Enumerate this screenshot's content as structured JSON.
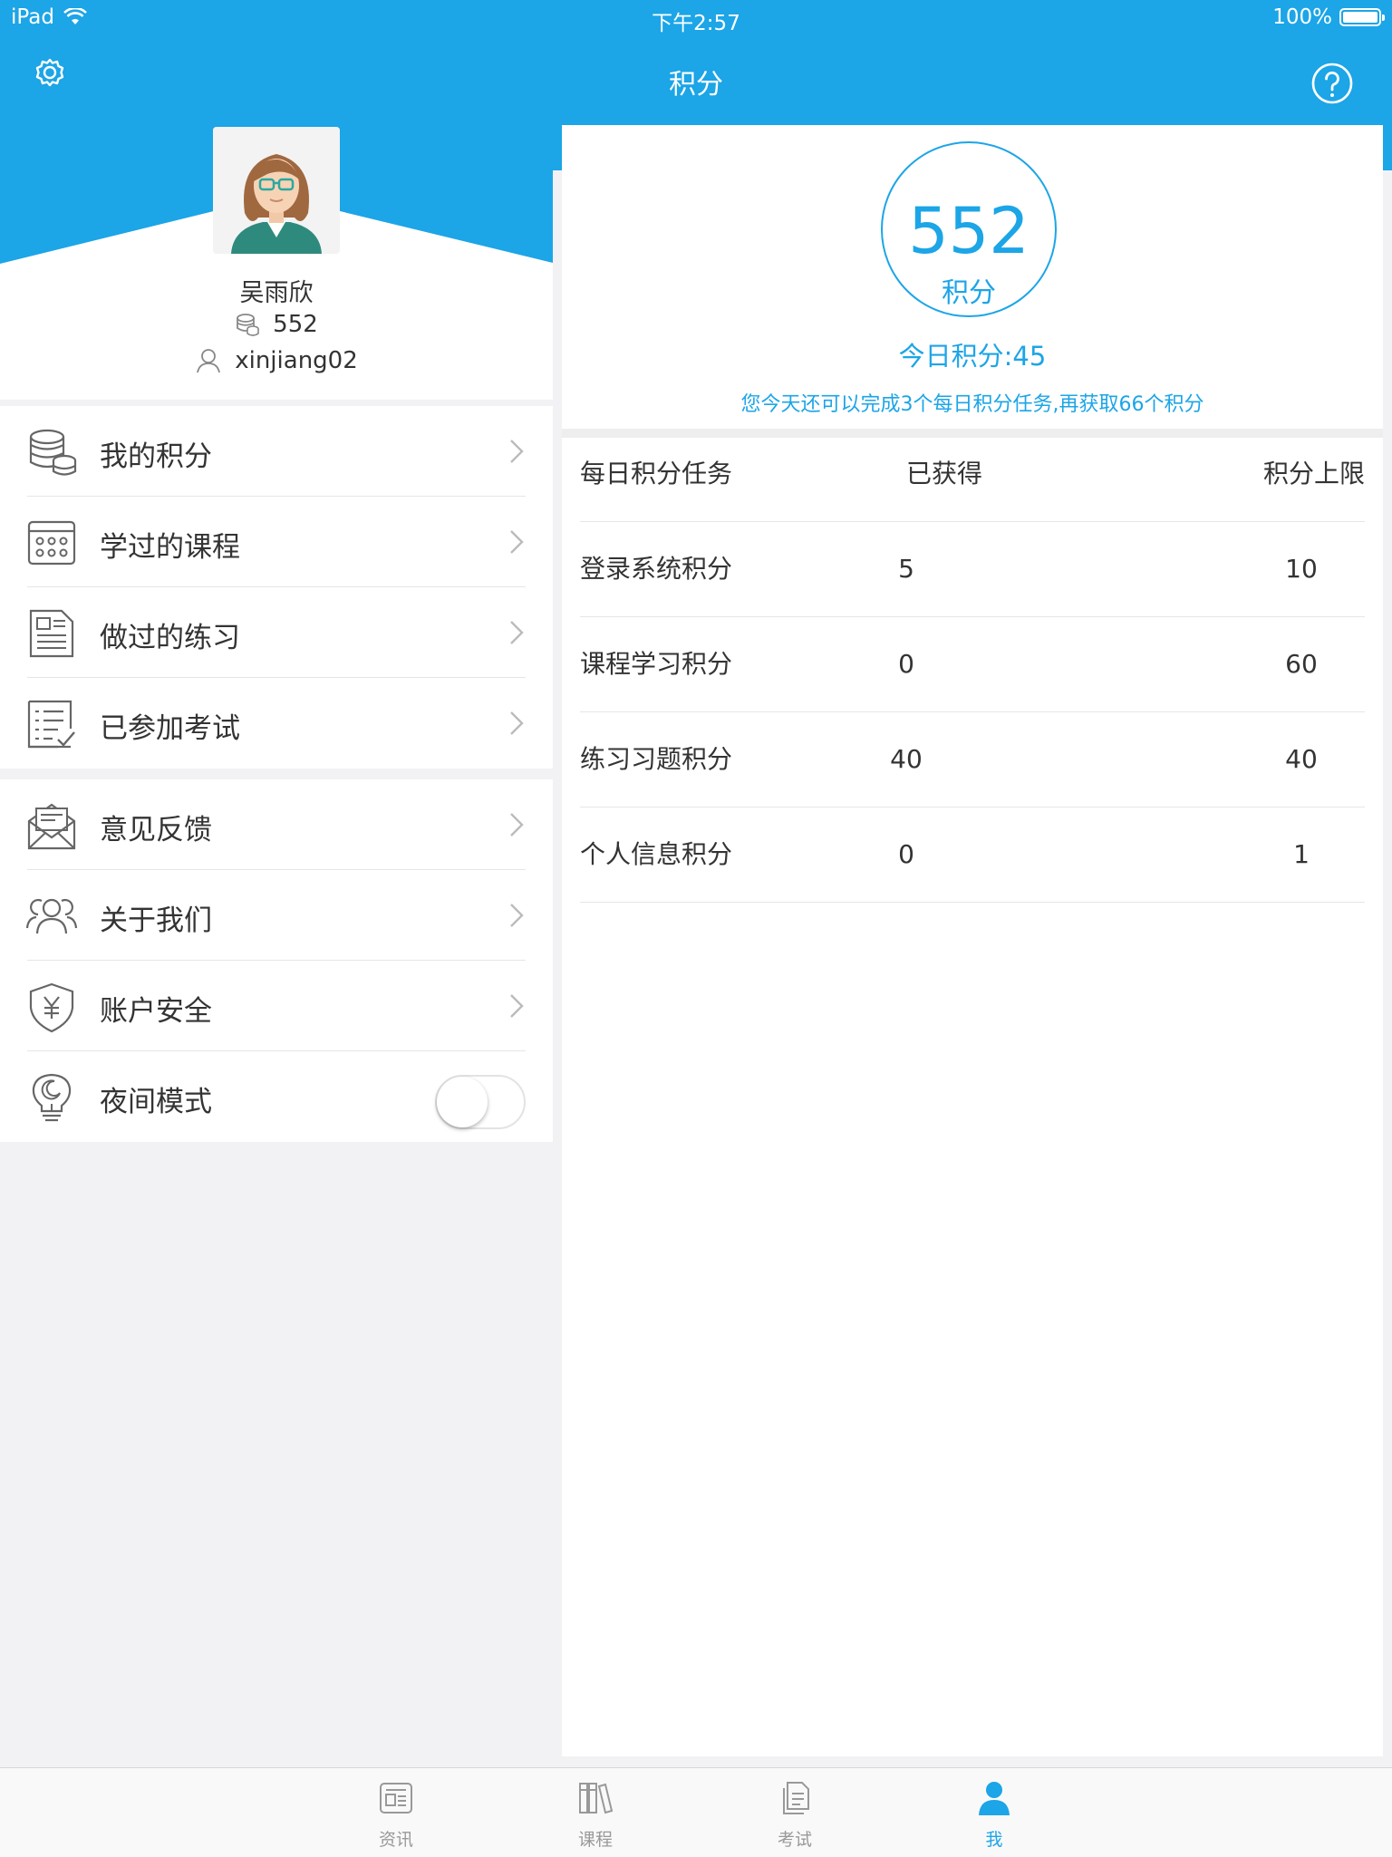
{
  "status_bar": {
    "device": "iPad",
    "time": "下午2:57",
    "battery": "100%"
  },
  "nav": {
    "title": "积分",
    "settings_icon": "gear-icon",
    "help_icon": "question-circle-icon"
  },
  "profile": {
    "name": "吴雨欣",
    "points": "552",
    "username": "xinjiang02"
  },
  "menu": {
    "group1": [
      {
        "label": "我的积分",
        "icon": "coins-stack-icon"
      },
      {
        "label": "学过的课程",
        "icon": "calendar-grid-icon"
      },
      {
        "label": "做过的练习",
        "icon": "document-icon"
      },
      {
        "label": "已参加考试",
        "icon": "checklist-icon"
      }
    ],
    "group2": [
      {
        "label": "意见反馈",
        "icon": "envelope-icon"
      },
      {
        "label": "关于我们",
        "icon": "users-icon"
      },
      {
        "label": "账户安全",
        "icon": "shield-yen-icon"
      },
      {
        "label": "夜间模式",
        "icon": "lightbulb-moon-icon"
      }
    ],
    "night_mode_on": false
  },
  "score": {
    "value": "552",
    "unit": "积分",
    "today": "今日积分:45",
    "hint": "您今天还可以完成3个每日积分任务,再获取66个积分"
  },
  "tasks": {
    "headers": [
      "每日积分任务",
      "已获得",
      "积分上限"
    ],
    "rows": [
      {
        "name": "登录系统积分",
        "earned": "5",
        "limit": "10"
      },
      {
        "name": "课程学习积分",
        "earned": "0",
        "limit": "60"
      },
      {
        "name": "练习习题积分",
        "earned": "40",
        "limit": "40"
      },
      {
        "name": "个人信息积分",
        "earned": "0",
        "limit": "1"
      }
    ]
  },
  "tabs": [
    {
      "label": "资讯",
      "icon": "news-icon",
      "active": false
    },
    {
      "label": "课程",
      "icon": "books-icon",
      "active": false
    },
    {
      "label": "考试",
      "icon": "exam-paper-icon",
      "active": false
    },
    {
      "label": "我",
      "icon": "person-icon",
      "active": true
    }
  ],
  "colors": {
    "accent": "#1ca5e7",
    "text": "#333333",
    "muted": "#999999"
  }
}
